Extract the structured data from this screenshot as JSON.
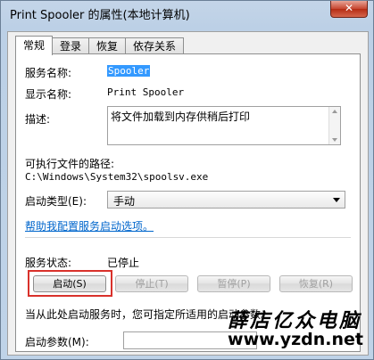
{
  "window": {
    "title": "Print Spooler 的属性(本地计算机)",
    "close_label": "✕"
  },
  "tabs": [
    {
      "label": "常规",
      "active": true
    },
    {
      "label": "登录",
      "active": false
    },
    {
      "label": "恢复",
      "active": false
    },
    {
      "label": "依存关系",
      "active": false
    }
  ],
  "general": {
    "service_name_label": "服务名称:",
    "service_name_value": "Spooler",
    "display_name_label": "显示名称:",
    "display_name_value": "Print Spooler",
    "description_label": "描述:",
    "description_value": "将文件加载到内存供稍后打印",
    "exe_path_label": "可执行文件的路径:",
    "exe_path_value": "C:\\Windows\\System32\\spoolsv.exe",
    "startup_type_label": "启动类型(E):",
    "startup_type_value": "手动",
    "help_link": "帮助我配置服务启动选项。",
    "status_label": "服务状态:",
    "status_value": "已停止",
    "start_button": "启动(S)",
    "stop_button": "停止(T)",
    "pause_button": "暂停(P)",
    "resume_button": "恢复(R)",
    "hint_text": "当从此处启动服务时，您可指定所适用的启动参数。",
    "start_params_label": "启动参数(M):",
    "start_params_value": ""
  },
  "watermark": {
    "chinese": "薛店亿众电脑",
    "url": "www.yzdn.net"
  },
  "colors": {
    "highlight_border": "#d9312b",
    "link": "#0066cc",
    "selection": "#3399ff"
  }
}
